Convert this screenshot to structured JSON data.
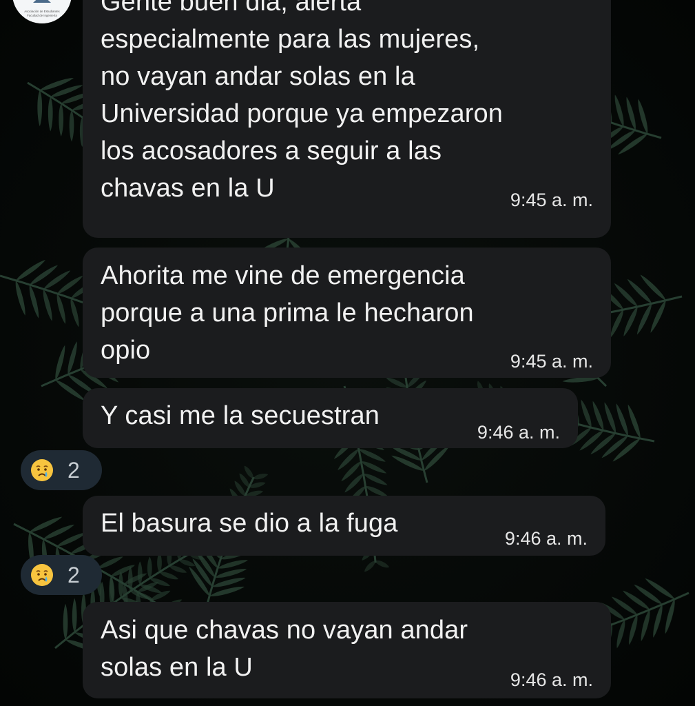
{
  "chat": {
    "messages": [
      {
        "lines": [
          "Gente buen dia, alerta",
          "especialmente para las mujeres,",
          "no vayan andar solas en la",
          "Universidad  porque ya empezaron",
          "los acosadores  a seguir a las",
          "chavas  en la U"
        ],
        "time": "9:45 a. m."
      },
      {
        "lines": [
          "Ahorita me vine de emergencia",
          "porque  a una prima le hecharon",
          "opio"
        ],
        "time": "9:45 a. m."
      },
      {
        "lines": [
          "Y casi me la secuestran"
        ],
        "time": "9:46 a. m.",
        "reaction": {
          "icon": "crying-face-emoji",
          "count": "2"
        }
      },
      {
        "lines": [
          "El basura  se dio a la fuga"
        ],
        "time": "9:46 a. m.",
        "reaction": {
          "icon": "crying-face-emoji",
          "count": "2"
        }
      },
      {
        "lines": [
          "Asi que chavas  no vayan andar",
          "solas en la U"
        ],
        "time": "9:46 a. m."
      }
    ],
    "sender_avatar": {
      "icon": "association-logo",
      "caption_lines": [
        "Asociación de Estudiantes",
        "Facultad de Ingeniería"
      ]
    }
  },
  "colors": {
    "bubble": "#1b1c1e",
    "reaction_pill": "#1f2a34",
    "background": "#050806",
    "leaves": "#2f4a3a"
  }
}
